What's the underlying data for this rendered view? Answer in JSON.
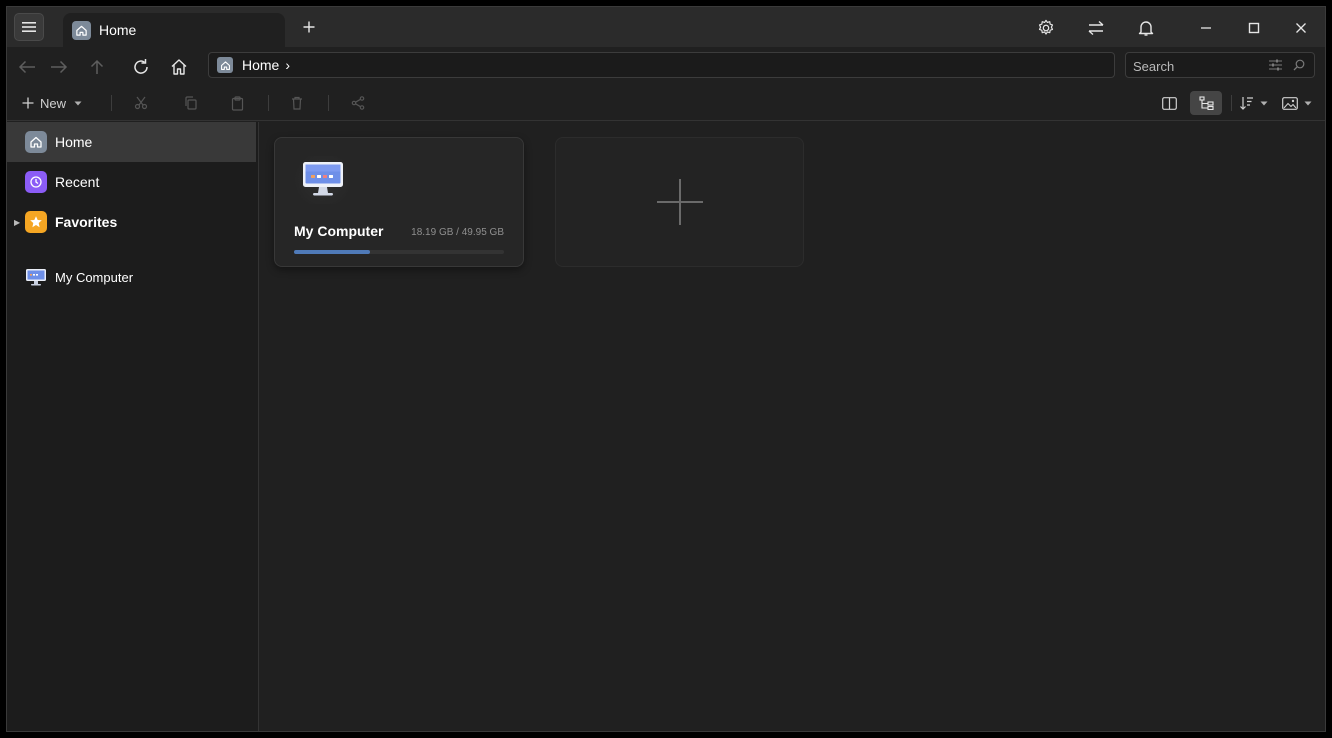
{
  "titlebar": {
    "tab_label": "Home"
  },
  "navbar": {
    "breadcrumb": [
      {
        "label": "Home"
      }
    ],
    "breadcrumb_separator": "›",
    "search_placeholder": "Search"
  },
  "toolbar": {
    "new_label": "New"
  },
  "sidebar": {
    "items": [
      {
        "label": "Home"
      },
      {
        "label": "Recent"
      },
      {
        "label": "Favorites"
      },
      {
        "label": "My Computer"
      }
    ]
  },
  "main": {
    "drives": [
      {
        "name": "My Computer",
        "size_text": "18.19 GB / 49.95 GB",
        "used_fraction": 0.364
      }
    ]
  },
  "colors": {
    "accent": "#4f7ab8",
    "recent_badge": "#8b5cf6",
    "favorites_badge": "#f5a623",
    "home_badge": "#7d8a99"
  }
}
